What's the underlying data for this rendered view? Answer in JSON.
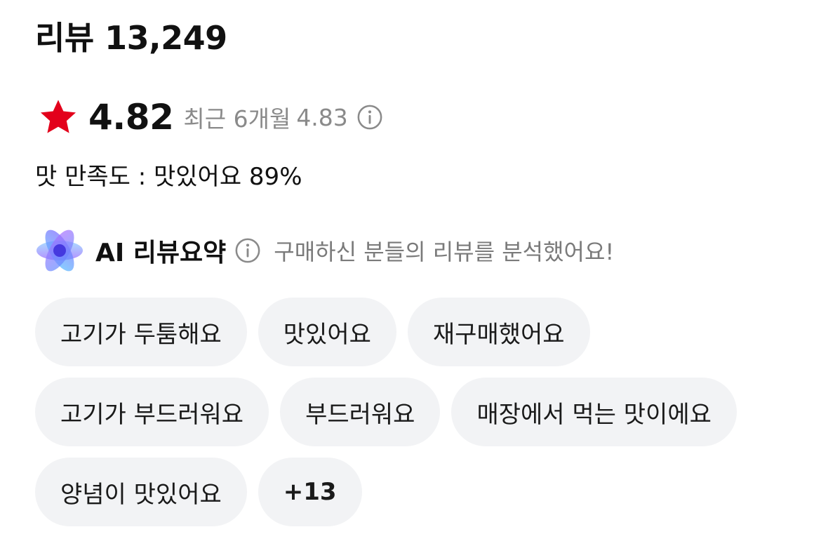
{
  "reviews": {
    "title": "리뷰 13,249"
  },
  "rating": {
    "score": "4.82",
    "recent_label": "최근 6개월",
    "recent_score": "4.83",
    "star_color": "#e3001b"
  },
  "taste": {
    "text": "맛 만족도 : 맛있어요 89%"
  },
  "ai_summary": {
    "title": "AI 리뷰요약",
    "description": "구매하신 분들의 리뷰를 분석했어요!"
  },
  "tags": [
    "고기가 두툼해요",
    "맛있어요",
    "재구매했어요",
    "고기가 부드러워요",
    "부드러워요",
    "매장에서 먹는 맛이에요",
    "양념이 맛있어요"
  ],
  "more_tags": "+13",
  "colors": {
    "chip_bg": "#f2f3f5",
    "muted_text": "#8a8a8a"
  }
}
